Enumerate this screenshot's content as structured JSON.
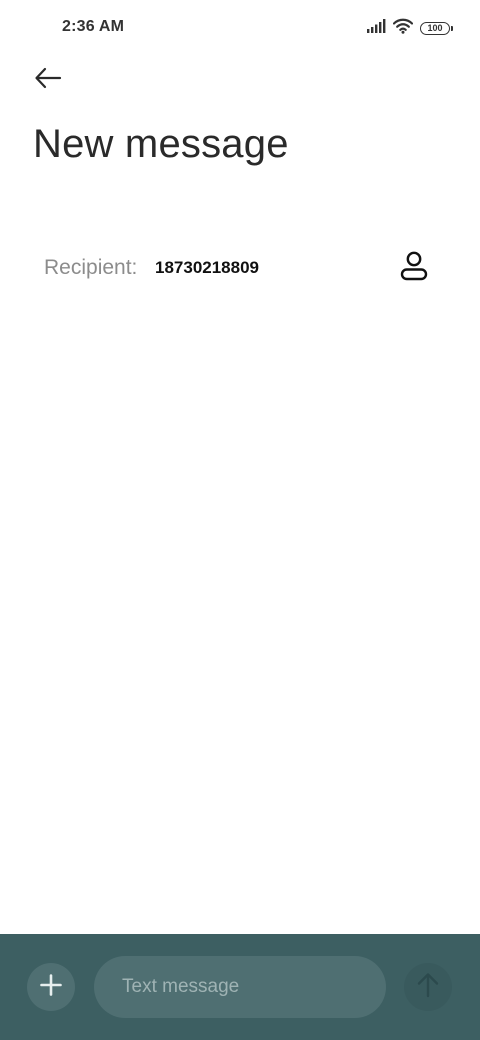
{
  "status_bar": {
    "time": "2:36 AM",
    "battery_level": "100",
    "icons": [
      "signal-icon",
      "wifi-icon",
      "battery-icon"
    ]
  },
  "header": {
    "back_icon": "back-arrow-icon",
    "title": "New message"
  },
  "recipient": {
    "label": "Recipient:",
    "value": "18730218809",
    "contact_icon": "contact-person-icon"
  },
  "compose": {
    "add_icon": "plus-icon",
    "placeholder": "Text message",
    "value": "",
    "send_icon": "send-arrow-up-icon"
  },
  "colors": {
    "compose_bar_bg": "#3d5f62",
    "compose_control_bg": "#4f6f72",
    "label_gray": "#8c8c8c"
  }
}
